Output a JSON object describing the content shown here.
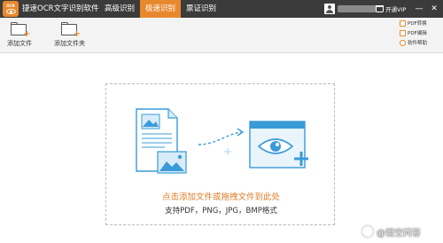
{
  "app": {
    "logo_text": "OCR",
    "title": "捷速OCR文字识别软件"
  },
  "tabs": [
    {
      "label": "高级识别",
      "active": false
    },
    {
      "label": "极速识别",
      "active": true
    },
    {
      "label": "票证识别",
      "active": false
    }
  ],
  "topbar": {
    "vip_label": "开通VIP",
    "minimize_glyph": "—",
    "close_glyph": "✕"
  },
  "toolbar": {
    "add_file_label": "添加文件",
    "add_folder_label": "添加文件夹"
  },
  "side_links": [
    {
      "label": "PDF转换",
      "icon": "pdf-convert-icon"
    },
    {
      "label": "PDF编辑",
      "icon": "pdf-edit-icon"
    },
    {
      "label": "软件帮助",
      "icon": "help-icon"
    }
  ],
  "dropzone": {
    "prompt": "点击添加文件或拖拽文件到此处",
    "formats": "支持PDF，PNG，JPG，BMP格式"
  },
  "watermark": {
    "text": "@悟空问答"
  },
  "colors": {
    "accent": "#e8882d",
    "topbar_bg": "#3b3b3b",
    "illustration_blue": "#3a9bd9",
    "illustration_light": "#d8ecf8"
  }
}
